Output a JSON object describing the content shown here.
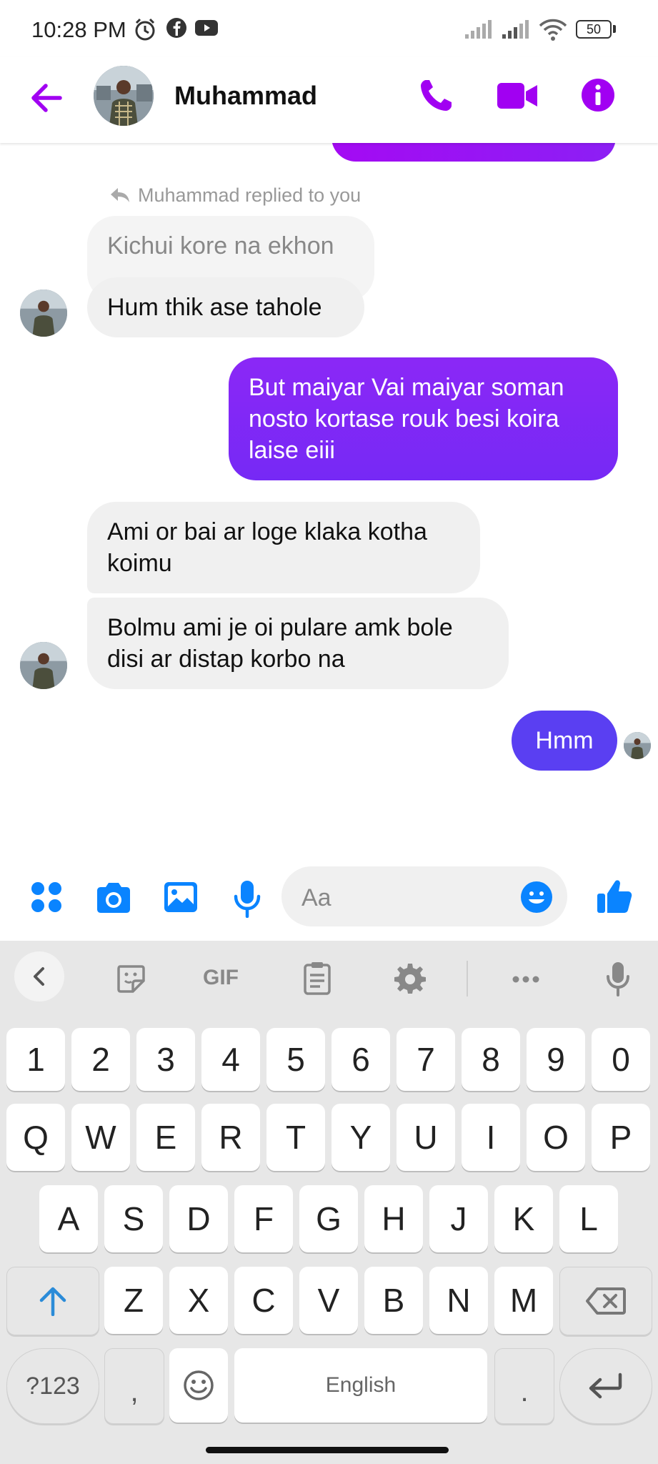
{
  "status_bar": {
    "time": "10:28 PM",
    "battery": "50",
    "icons": [
      "alarm-icon",
      "facebook-icon",
      "youtube-icon",
      "signal-icon",
      "signal-icon",
      "wifi-icon",
      "battery-icon"
    ]
  },
  "header": {
    "contact_name": "Muhammad",
    "icons": [
      "back-arrow-icon",
      "phone-icon",
      "video-camera-icon",
      "info-icon"
    ]
  },
  "conversation": {
    "reply_note": "Muhammad replied to you",
    "messages": [
      {
        "direction": "in",
        "text": "Kichui kore na ekhon",
        "type": "quoted"
      },
      {
        "direction": "in",
        "text": "Hum thik ase tahole"
      },
      {
        "direction": "out",
        "lines": [
          "But maiyar Vai maiyar soman",
          "nosto kortase rouk besi koira",
          "laise eiii"
        ]
      },
      {
        "direction": "in",
        "lines": [
          "Ami or bai ar loge klaka kotha",
          "koimu"
        ]
      },
      {
        "direction": "in",
        "lines": [
          "Bolmu ami je oi pulare amk bole",
          "disi ar distap korbo na"
        ]
      },
      {
        "direction": "out",
        "text": "Hmm"
      }
    ]
  },
  "composer": {
    "placeholder": "Aa",
    "icons": [
      "apps-grid-icon",
      "camera-icon",
      "image-icon",
      "microphone-icon",
      "emoji-icon",
      "thumbs-up-icon"
    ]
  },
  "keyboard": {
    "toolbar": {
      "gif_label": "GIF",
      "icons": [
        "chevron-left-icon",
        "sticker-icon",
        "gif-icon",
        "clipboard-icon",
        "settings-icon",
        "more-icon",
        "voice-input-icon"
      ]
    },
    "rows": [
      [
        "1",
        "2",
        "3",
        "4",
        "5",
        "6",
        "7",
        "8",
        "9",
        "0"
      ],
      [
        "Q",
        "W",
        "E",
        "R",
        "T",
        "Y",
        "U",
        "I",
        "O",
        "P"
      ],
      [
        "A",
        "S",
        "D",
        "F",
        "G",
        "H",
        "J",
        "K",
        "L"
      ],
      [
        "Z",
        "X",
        "C",
        "V",
        "B",
        "N",
        "M"
      ]
    ],
    "symbols_label": "?123",
    "comma_label": ",",
    "space_label": "English",
    "period_label": "."
  },
  "colors": {
    "accent_purple": "#a100f2",
    "bubble_purple": "#7b25f5",
    "bubble_indigo": "#5a3ff2",
    "incoming_bubble": "#f0f0f0",
    "messenger_blue": "#0a84ff"
  }
}
